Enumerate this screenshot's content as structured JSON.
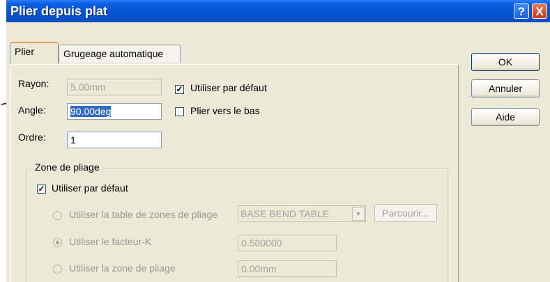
{
  "dialog": {
    "title": "Plier depuis plat",
    "help_glyph": "?",
    "close_glyph": "X"
  },
  "tabs": [
    "Plier",
    "Grugeage automatique"
  ],
  "form": {
    "rayon_label": "Rayon:",
    "rayon_value": "5.00mm",
    "angle_label": "Angle:",
    "angle_value": "90.00deg",
    "ordre_label": "Ordre:",
    "ordre_value": "1",
    "use_default_label": "Utiliser par défaut",
    "use_default_checked": true,
    "bend_down_label": "Plier vers le bas",
    "bend_down_checked": false
  },
  "zone": {
    "title": "Zone de pliage",
    "use_default_label": "Utiliser par défaut",
    "use_default_checked": true,
    "opt_table_label": "Utiliser la table de zones de pliage",
    "table_select_value": "BASE BEND TABLE",
    "browse_label": "Parcourir...",
    "opt_k_label": "Utiliser le facteur-K",
    "k_value": "0.500000",
    "opt_zone_label": "Utiliser la zone de pliage",
    "zone_value": "0.00mm"
  },
  "buttons": {
    "ok": "OK",
    "cancel": "Annuler",
    "help": "Aide"
  },
  "colors": {
    "titlebar": "#0553d2",
    "dialog_bg": "#ece9d8",
    "selection": "#316ac5"
  }
}
